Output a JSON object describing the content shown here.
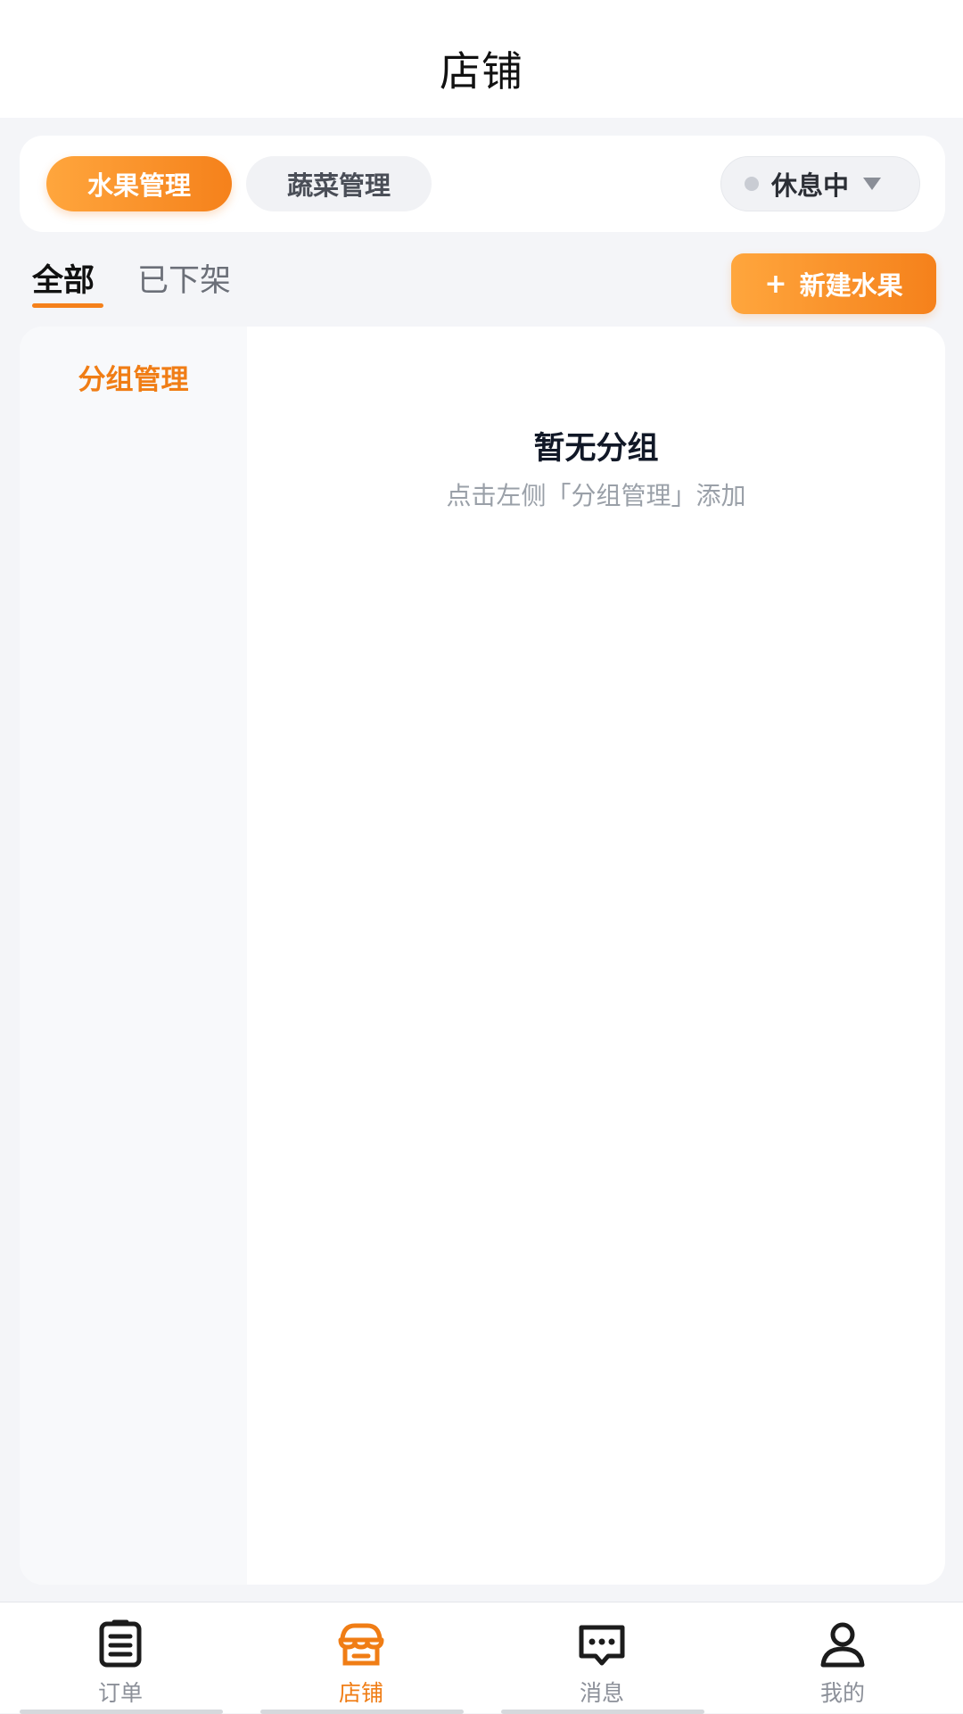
{
  "header": {
    "title": "店铺"
  },
  "category_bar": {
    "active_label": "水果管理",
    "inactive_label": "蔬菜管理",
    "status": {
      "label": "休息中"
    }
  },
  "tabs": [
    {
      "label": "全部",
      "active": true
    },
    {
      "label": "已下架",
      "active": false
    }
  ],
  "new_button": {
    "icon": "+",
    "label": "新建水果"
  },
  "left_pane": {
    "group_mgmt_label": "分组管理"
  },
  "empty_state": {
    "title": "暂无分组",
    "hint": "点击左侧「分组管理」添加"
  },
  "bottom_nav": {
    "items": [
      {
        "label": "订单",
        "icon": "order-list-icon"
      },
      {
        "label": "店铺",
        "icon": "store-icon",
        "active": true
      },
      {
        "label": "消息",
        "icon": "message-icon"
      },
      {
        "label": "我的",
        "icon": "profile-icon"
      }
    ]
  },
  "colors": {
    "accent": "#f5811b",
    "accent_light": "#ffa63d",
    "background": "#f4f5f8"
  }
}
